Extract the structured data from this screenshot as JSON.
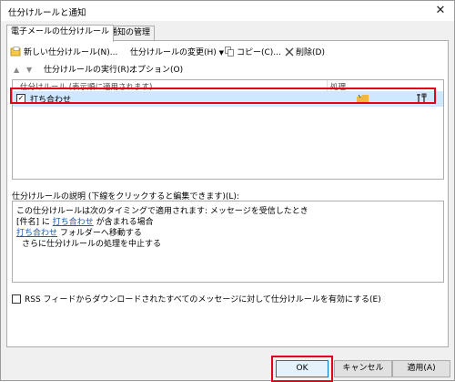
{
  "window": {
    "title": "仕分けルールと通知",
    "close_glyph": "✕"
  },
  "tabs": [
    {
      "label": "電子メールの仕分けルール"
    },
    {
      "label": "通知の管理"
    }
  ],
  "toolbar": {
    "new_rule": "新しい仕分けルール(N)...",
    "change_rule": "仕分けルールの変更(H)",
    "copy": "コピー(C)...",
    "delete": "削除(D)",
    "run_rules": "仕分けルールの実行(R)...",
    "options": "オプション(O)"
  },
  "rule_list": {
    "col_rule": "仕分けルール (表示順に適用されます)",
    "col_action": "処理",
    "rules": [
      {
        "name": "打ち合わせ",
        "checked": true,
        "checkmark": "✓",
        "action_icons": [
          "folder-move-icon",
          "rule-tools-icon"
        ]
      }
    ]
  },
  "description": {
    "label": "仕分けルールの説明 (下線をクリックすると編集できます)(L):",
    "lines": [
      {
        "text": "この仕分けルールは次のタイミングで適用されます: メッセージを受信したとき"
      },
      {
        "prefix": "[件名] に ",
        "link": "打ち合わせ",
        "suffix": " が含まれる場合"
      },
      {
        "link": "打ち合わせ",
        "suffix": " フォルダーへ移動する"
      },
      {
        "text": "さらに仕分けルールの処理を中止する"
      }
    ]
  },
  "rss_option": {
    "label": "RSS フィードからダウンロードされたすべてのメッセージに対して仕分けルールを有効にする(E)",
    "checked": false
  },
  "buttons": {
    "ok": "OK",
    "cancel": "キャンセル",
    "apply": "適用(A)"
  },
  "colors": {
    "highlight": "#e3001b",
    "selection": "#cde8ff",
    "link": "#1a5bb8"
  }
}
